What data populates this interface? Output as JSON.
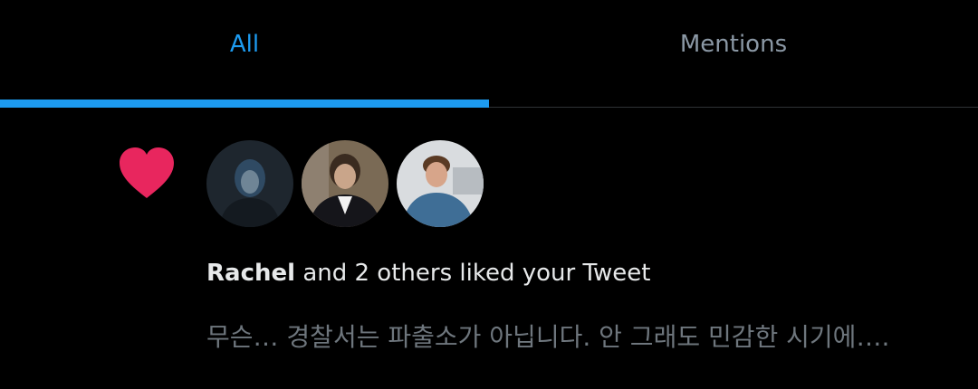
{
  "tabs": {
    "all_label": "All",
    "mentions_label": "Mentions",
    "active": "All"
  },
  "colors": {
    "accent": "#1d9bf0",
    "like": "#f91880",
    "background": "#000000",
    "muted_text": "#6e767d"
  },
  "notification": {
    "icon": "heart-icon",
    "avatars": [
      "avatar-user-1",
      "avatar-user-2",
      "avatar-user-3"
    ],
    "user_name": "Rachel",
    "action_text": "and 2 others liked your Tweet",
    "tweet_excerpt": "무슨… 경찰서는 파출소가 아닙니다. 안 그래도 민감한 시기에…."
  }
}
